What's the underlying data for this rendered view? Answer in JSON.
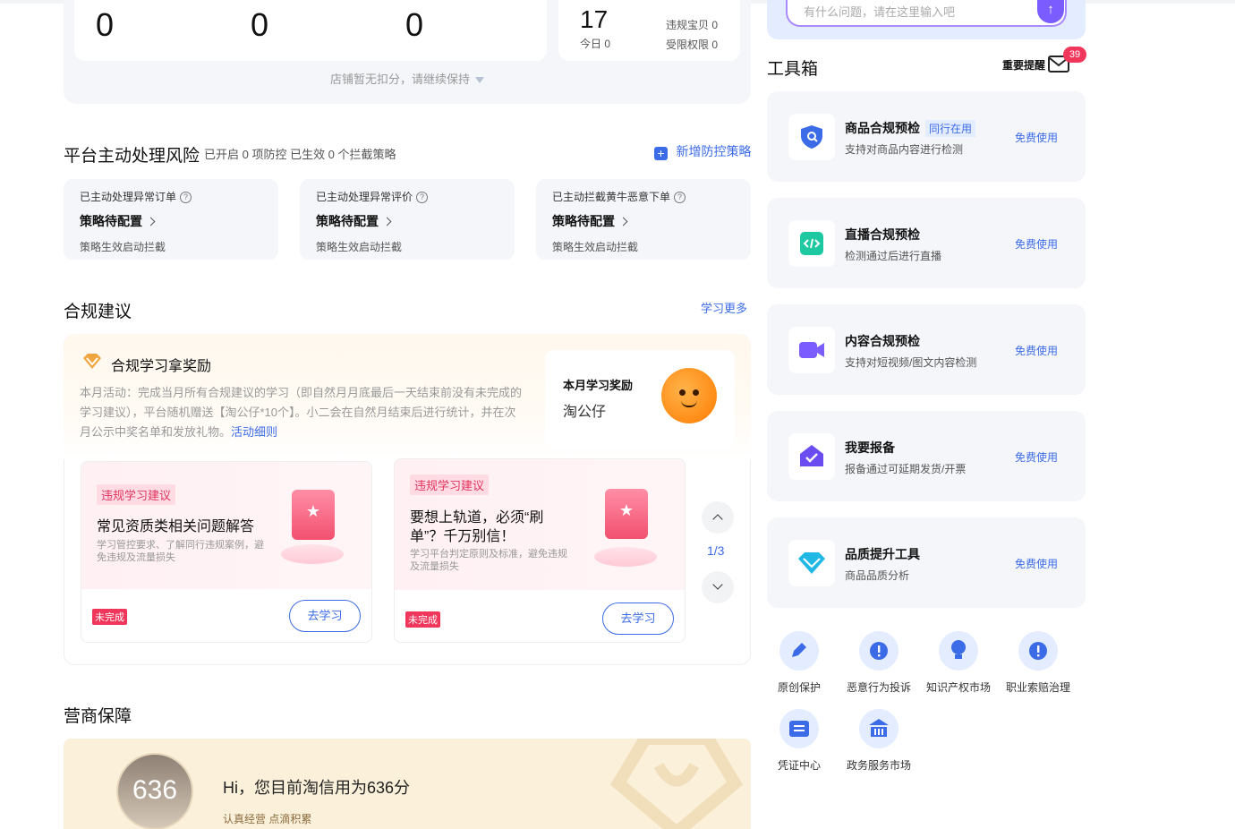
{
  "stats": {
    "values": [
      "0",
      "0",
      "0"
    ],
    "today_total": "17",
    "today_label": "今日 0",
    "violation_label": "违规宝贝 0",
    "restricted_label": "受限权限 0",
    "note": "店铺暂无扣分，请继续保持"
  },
  "risk": {
    "title": "平台主动处理风险",
    "subtitle": "已开启 0 项防控 已生效 0 个拦截策略",
    "add_label": "新增防控策略",
    "cards": [
      {
        "title": "已主动处理异常订单",
        "status": "策略待配置",
        "desc": "策略生效启动拦截"
      },
      {
        "title": "已主动处理异常评价",
        "status": "策略待配置",
        "desc": "策略生效启动拦截"
      },
      {
        "title": "已主动拦截黄牛恶意下单",
        "status": "策略待配置",
        "desc": "策略生效启动拦截"
      }
    ]
  },
  "compliance": {
    "title": "合规建议",
    "more_label": "学习更多",
    "reward_title": "合规学习拿奖励",
    "activity_text": "本月活动：完成当月所有合规建议的学习（即自然月月底最后一天结束前没有未完成的学习建议），平台随机赠送【淘公仔*10个】。小二会在自然月结束后进行统计，并在次月公示中奖名单和发放礼物。",
    "activity_link": "活动细则",
    "reward_box_title": "本月学习奖励",
    "reward_box_item": "淘公仔",
    "pager": "1/3",
    "courses": [
      {
        "tag": "违规学习建议",
        "title": "常见资质类相关问题解答",
        "desc": "学习管控要求、了解同行违规案例，避免违规及流量损失",
        "status": "未完成",
        "button": "去学习"
      },
      {
        "tag": "违规学习建议",
        "title": "要想上轨道，必须“刷单”？千万别信！",
        "desc": "学习平台判定原则及标准，避免违规及流量损失",
        "status": "未完成",
        "button": "去学习"
      }
    ]
  },
  "guarantee": {
    "title": "营商保障",
    "score": "636",
    "greeting": "Hi，您目前淘信用为636分",
    "slogan": "认真经营 点滴积累"
  },
  "sidebar": {
    "search_placeholder": "有什么问题，请在这里输入吧",
    "toolbox_title": "工具箱",
    "reminder_label": "重要提醒",
    "reminder_count": "39",
    "tools": [
      {
        "name": "商品合规预检",
        "tag": "同行在用",
        "desc": "支持对商品内容进行检测",
        "link": "免费使用",
        "icon": "shield-search-icon",
        "color": "#3b6be6"
      },
      {
        "name": "直播合规预检",
        "tag": "",
        "desc": "检测通过后进行直播",
        "link": "免费使用",
        "icon": "code-icon",
        "color": "#1ec8a0"
      },
      {
        "name": "内容合规预检",
        "tag": "",
        "desc": "支持对短视频/图文内容检测",
        "link": "免费使用",
        "icon": "video-icon",
        "color": "#7a5cff"
      },
      {
        "name": "我要报备",
        "tag": "",
        "desc": "报备通过可延期发货/开票",
        "link": "免费使用",
        "icon": "home-check-icon",
        "color": "#6a4cf0"
      },
      {
        "name": "品质提升工具",
        "tag": "",
        "desc": "商品品质分析",
        "link": "免费使用",
        "icon": "diamond-icon",
        "color": "#22b8e6"
      }
    ],
    "shortcuts": [
      {
        "label": "原创保护",
        "icon": "pen-icon"
      },
      {
        "label": "恶意行为投诉",
        "icon": "alert-icon"
      },
      {
        "label": "知识产权市场",
        "icon": "bulb-icon"
      },
      {
        "label": "职业索赔治理",
        "icon": "alert-icon"
      },
      {
        "label": "凭证中心",
        "icon": "ticket-icon"
      },
      {
        "label": "政务服务市场",
        "icon": "bank-icon"
      }
    ]
  }
}
